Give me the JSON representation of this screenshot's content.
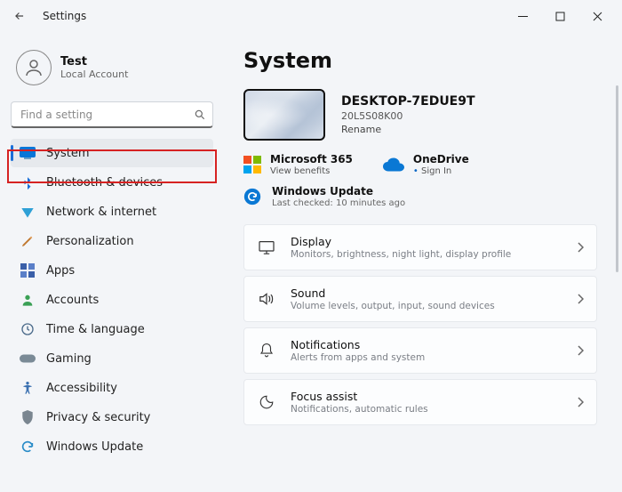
{
  "window": {
    "title": "Settings"
  },
  "profile": {
    "name": "Test",
    "subtitle": "Local Account"
  },
  "search": {
    "placeholder": "Find a setting"
  },
  "sidebar": {
    "items": [
      {
        "label": "System",
        "icon": "system",
        "selected": true
      },
      {
        "label": "Bluetooth & devices",
        "icon": "bluetooth"
      },
      {
        "label": "Network & internet",
        "icon": "network"
      },
      {
        "label": "Personalization",
        "icon": "personalization"
      },
      {
        "label": "Apps",
        "icon": "apps"
      },
      {
        "label": "Accounts",
        "icon": "accounts"
      },
      {
        "label": "Time & language",
        "icon": "time"
      },
      {
        "label": "Gaming",
        "icon": "gaming"
      },
      {
        "label": "Accessibility",
        "icon": "accessibility"
      },
      {
        "label": "Privacy & security",
        "icon": "privacy"
      },
      {
        "label": "Windows Update",
        "icon": "update"
      }
    ]
  },
  "main": {
    "heading": "System",
    "device": {
      "name": "DESKTOP-7EDUE9T",
      "model": "20L5S08K00",
      "rename": "Rename"
    },
    "services": {
      "m365": {
        "title": "Microsoft 365",
        "sub": "View benefits"
      },
      "onedrive": {
        "title": "OneDrive",
        "sub": "Sign In"
      }
    },
    "update": {
      "title": "Windows Update",
      "sub": "Last checked: 10 minutes ago"
    },
    "cards": [
      {
        "title": "Display",
        "sub": "Monitors, brightness, night light, display profile",
        "icon": "display"
      },
      {
        "title": "Sound",
        "sub": "Volume levels, output, input, sound devices",
        "icon": "sound"
      },
      {
        "title": "Notifications",
        "sub": "Alerts from apps and system",
        "icon": "notifications"
      },
      {
        "title": "Focus assist",
        "sub": "Notifications, automatic rules",
        "icon": "focus"
      }
    ]
  }
}
